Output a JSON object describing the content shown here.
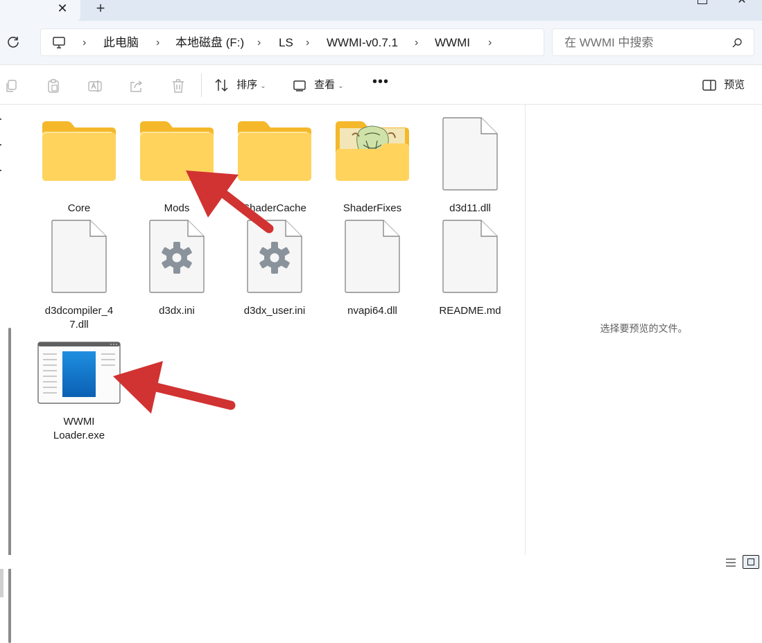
{
  "window": {
    "tab_close_glyph": "✕",
    "new_tab_glyph": "+",
    "close_glyph": "✕"
  },
  "address_bar": {
    "breadcrumb": [
      "此电脑",
      "本地磁盘 (F:)",
      "LS",
      "WWMI-v0.7.1",
      "WWMI"
    ],
    "chevron": "›",
    "search_placeholder": "在 WWMI 中搜索"
  },
  "toolbar": {
    "sort_label": "排序",
    "view_label": "查看",
    "more_label": "•••",
    "preview_label": "预览",
    "caret": "⌄"
  },
  "files": [
    {
      "name": "Core",
      "type": "folder"
    },
    {
      "name": "Mods",
      "type": "folder"
    },
    {
      "name": "ShaderCache",
      "type": "folder"
    },
    {
      "name": "ShaderFixes",
      "type": "folder-image"
    },
    {
      "name": "d3d11.dll",
      "type": "file"
    },
    {
      "name": "d3dcompiler_47.dll",
      "type": "file",
      "display": [
        "d3dcompiler_4",
        "7.dll"
      ]
    },
    {
      "name": "d3dx.ini",
      "type": "settings"
    },
    {
      "name": "d3dx_user.ini",
      "type": "settings"
    },
    {
      "name": "nvapi64.dll",
      "type": "file"
    },
    {
      "name": "README.md",
      "type": "file"
    },
    {
      "name": "WWMI Loader.exe",
      "type": "exe",
      "display": [
        "WWMI",
        "Loader.exe"
      ]
    }
  ],
  "preview_pane": {
    "message": "选择要预览的文件。"
  },
  "annotations": {
    "arrow_color": "#d13232"
  }
}
